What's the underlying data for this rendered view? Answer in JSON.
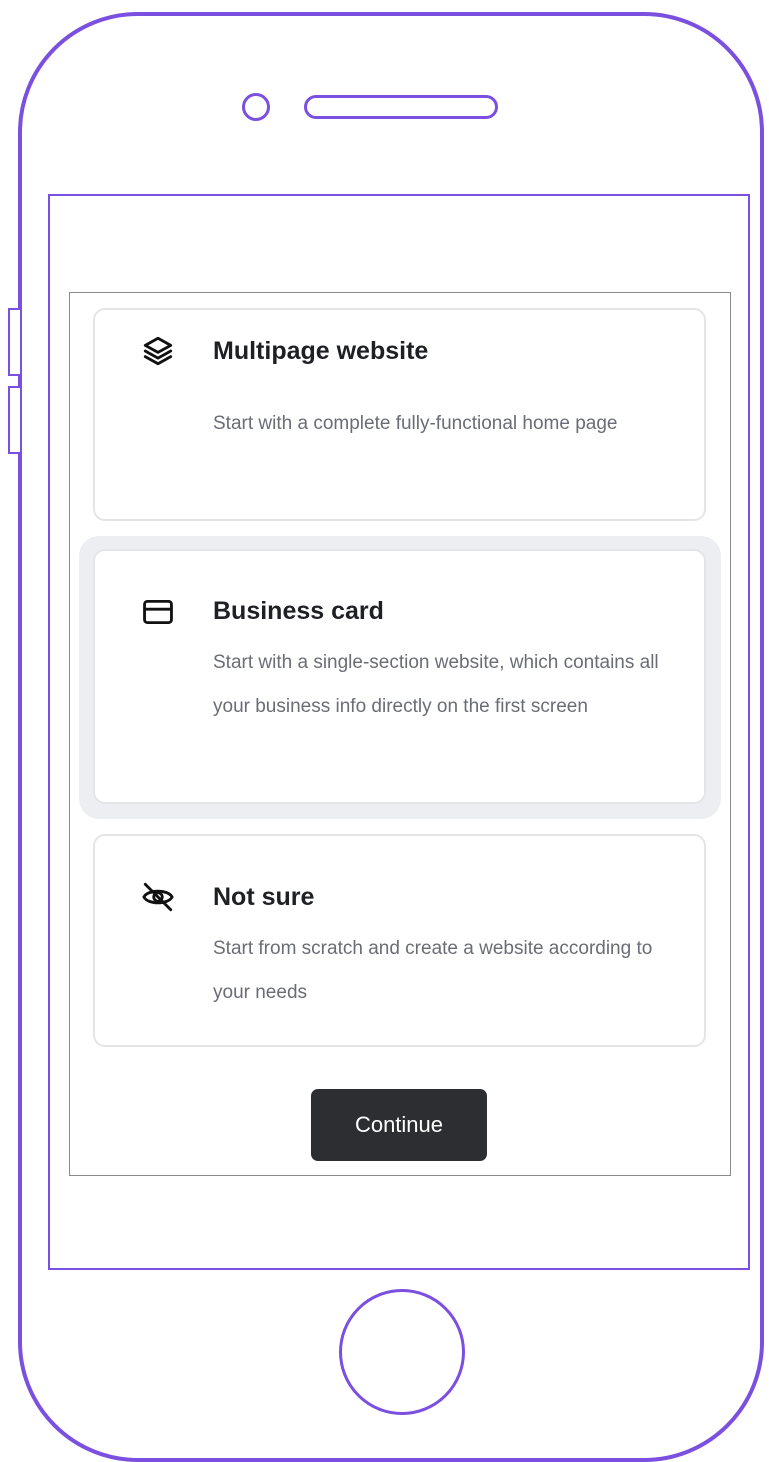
{
  "options": [
    {
      "icon": "layers-icon",
      "title": "Multipage website",
      "description": "Start with a complete fully-functional home page",
      "selected": false
    },
    {
      "icon": "card-icon",
      "title": "Business card",
      "description": "Start with a single-section website, which contains all your business info directly on the first screen",
      "selected": true
    },
    {
      "icon": "eye-off-icon",
      "title": "Not sure",
      "description": "Start from scratch and create a website according to your needs",
      "selected": false
    }
  ],
  "continue_label": "Continue",
  "colors": {
    "frame": "#7b4fe0",
    "button": "#2d2e31",
    "card_border": "#e4e5e8",
    "selected_halo": "#eceef2"
  }
}
